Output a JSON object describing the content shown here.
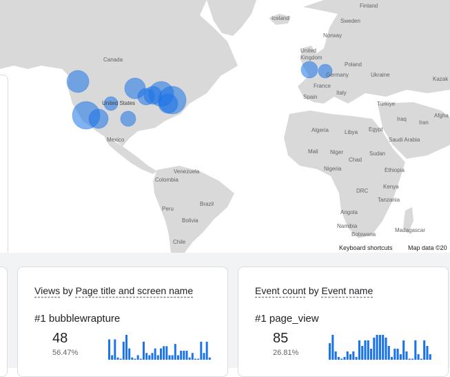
{
  "map": {
    "labels": {
      "finland": "Finland",
      "iceland": "Iceland",
      "sweden": "Sweden",
      "norway": "Norway",
      "united_kingdom": "United\nKingdom",
      "poland": "Poland",
      "germany": "Germany",
      "ukraine": "Ukraine",
      "kazakhstan": "Kazak",
      "canada": "Canada",
      "france": "France",
      "italy": "Italy",
      "spain": "Spain",
      "united_states": "United States",
      "turkiye": "Türkiye",
      "afghanistan": "Afgha",
      "iraq": "Iraq",
      "iran": "Iran",
      "mexico": "Mexico",
      "algeria": "Algeria",
      "libya": "Libya",
      "egypt": "Egypt",
      "saudi_arabia": "Saudi Arabia",
      "mali": "Mali",
      "niger": "Niger",
      "chad": "Chad",
      "sudan": "Sudan",
      "nigeria": "Nigeria",
      "ethiopia": "Ethiopia",
      "venezuela": "Venezuela",
      "colombia": "Colombia",
      "kenya": "Kenya",
      "drc": "DRC",
      "tanzania": "Tanzania",
      "peru": "Peru",
      "brazil": "Brazil",
      "angola": "Angola",
      "bolivia": "Bolivia",
      "namibia": "Namibia",
      "botswana": "Botswana",
      "madagascar": "Madagascar",
      "chile": "Chile"
    },
    "keyboard_shortcuts": "Keyboard shortcuts",
    "map_data": "Map data ©20",
    "bubble_color": "#1a73e8",
    "land_color": "#d9d9d9"
  },
  "cards": [
    {
      "metric_name": "Views",
      "by_word": " by ",
      "dimension_name": "Page title and screen name",
      "rank": "#1",
      "top_item": "bubblewrapture",
      "value": "48",
      "percent": "56.47%",
      "spark_values": [
        9,
        2,
        9,
        1,
        0,
        8,
        11,
        5,
        1,
        0,
        2,
        0,
        8,
        3,
        2,
        3,
        5,
        2,
        5,
        6,
        6,
        2,
        2,
        7,
        2,
        4,
        4,
        4,
        1,
        3,
        0,
        0,
        8,
        3,
        8,
        1
      ],
      "bar_color": "#1a73e8"
    },
    {
      "metric_name": "Event count",
      "by_word": " by ",
      "dimension_name": "Event name",
      "rank": "#1",
      "top_item": "page_view",
      "value": "85",
      "percent": "26.81%",
      "spark_values": [
        6,
        9,
        3,
        1,
        0,
        1,
        3,
        2,
        3,
        1,
        7,
        5,
        7,
        7,
        4,
        8,
        9,
        9,
        9,
        8,
        5,
        1,
        4,
        4,
        2,
        7,
        3,
        0,
        0,
        7,
        2,
        0,
        7,
        5,
        2
      ],
      "bar_color": "#1a73e8"
    }
  ]
}
